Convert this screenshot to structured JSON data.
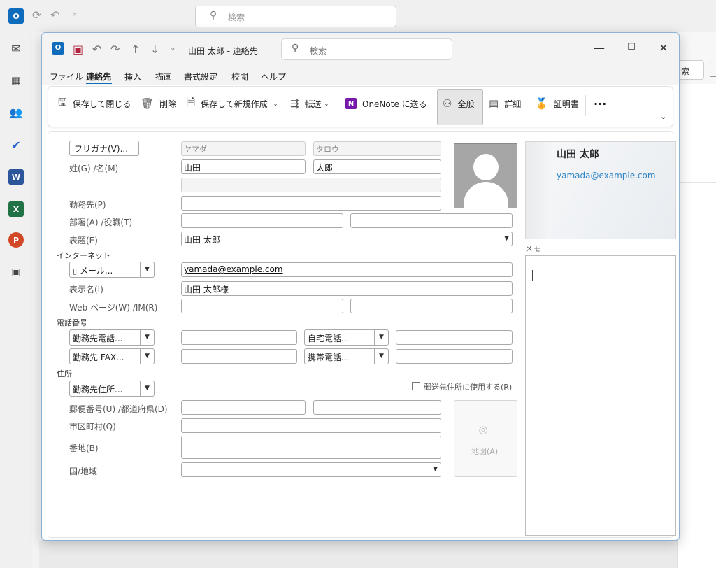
{
  "background": {
    "search_placeholder": "検索",
    "search_button_label": "索"
  },
  "window": {
    "title": "山田 太郎 - 連絡先",
    "search_placeholder": "検索"
  },
  "menu": {
    "items": [
      "ファイル",
      "連絡先",
      "挿入",
      "描画",
      "書式設定",
      "校閲",
      "ヘルプ"
    ],
    "active_index": 1
  },
  "ribbon": {
    "save_close": "保存して閉じる",
    "delete": "削除",
    "save_new": "保存して新規作成",
    "forward": "転送",
    "onenote": "OneNote に送る",
    "general": "全般",
    "details": "詳細",
    "certificate": "証明書",
    "more": "···"
  },
  "form": {
    "furigana_button": "フリガナ(V)...",
    "furigana_last": "ヤマダ",
    "furigana_first": "タロウ",
    "name_label": "姓(G)  /名(M)",
    "last_name": "山田",
    "first_name": "太郎",
    "company_label": "勤務先(P)",
    "dept_label": "部署(A)  /役職(T)",
    "file_as_label": "表題(E)",
    "file_as_value": "山田 太郎",
    "internet_section": "インターネット",
    "email_dropdown": "メール...",
    "email_value": "yamada@example.com",
    "display_name_label": "表示名(I)",
    "display_name_value": "山田 太郎様",
    "web_label": "Web ページ(W)  /IM(R)",
    "phone_section": "電話番号",
    "phone1_dropdown": "勤務先電話...",
    "phone2_dropdown": "勤務先 FAX...",
    "phone3_dropdown": "自宅電話...",
    "phone4_dropdown": "携帯電話...",
    "address_section": "住所",
    "address_dropdown": "勤務先住所...",
    "mailing_checkbox": "郵送先住所に使用する(R)",
    "postal_label": "郵便番号(U)  /都道府県(D)",
    "city_label": "市区町村(Q)",
    "street_label": "番地(B)",
    "country_label": "国/地域",
    "map_button": "地図(A)"
  },
  "card": {
    "name": "山田 太郎",
    "email": "yamada@example.com"
  },
  "memo": {
    "label": "メモ"
  }
}
